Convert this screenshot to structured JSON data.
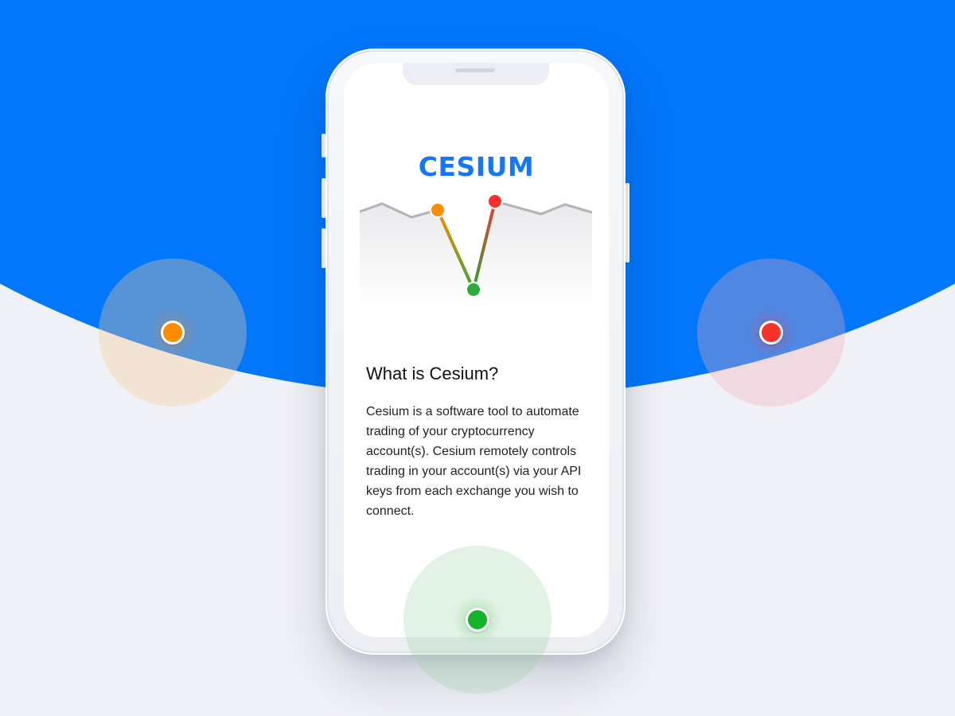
{
  "app": {
    "logo_text": "CESIUM"
  },
  "content": {
    "heading": "What is Cesium?",
    "body": "Cesium is a software tool to automate trading of your cryptocurrency account(s). Cesium remotely controls trading in your account(s) via your API keys from each exchange you wish to connect."
  },
  "colors": {
    "background_blue": "#0277fb",
    "background_light": "#f0f1f6",
    "brand_blue": "#1677f3",
    "marker_orange": "#fb8c00",
    "marker_red": "#f5322c",
    "marker_green": "#13b32b"
  },
  "markers": [
    {
      "name": "orange",
      "color": "#fb8c00"
    },
    {
      "name": "red",
      "color": "#f5322c"
    },
    {
      "name": "green",
      "color": "#13b32b"
    }
  ]
}
